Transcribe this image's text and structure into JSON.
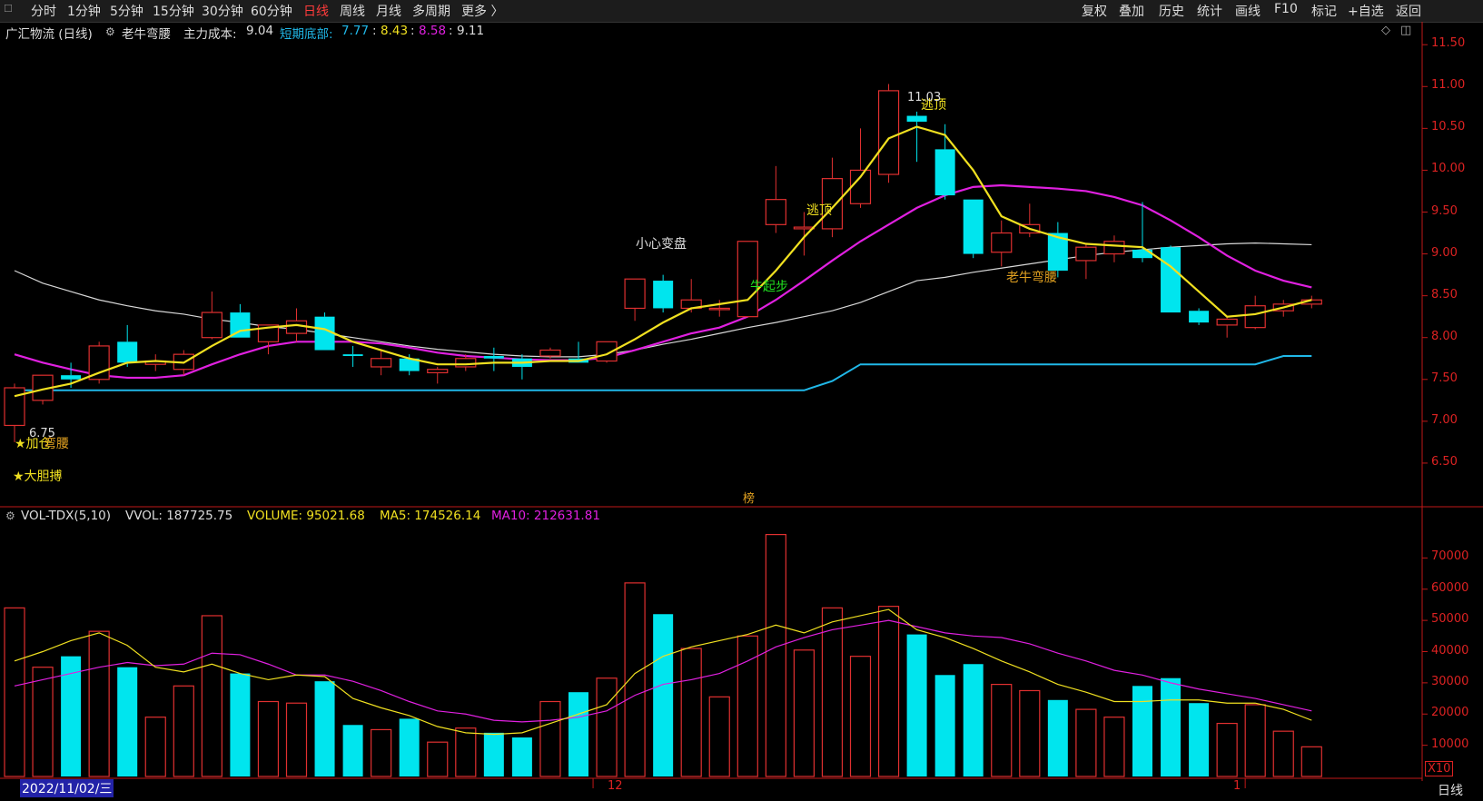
{
  "toolbar": {
    "left_items": [
      "分时",
      "1分钟",
      "5分钟",
      "15分钟",
      "30分钟",
      "60分钟",
      "日线",
      "周线",
      "月线",
      "多周期",
      "更多 〉"
    ],
    "active": "日线",
    "right_items": [
      "复权",
      "叠加",
      "历史",
      "统计",
      "画线",
      "F10",
      "标记",
      "+自选",
      "返回"
    ]
  },
  "header": {
    "stock": "广汇物流 (日线)",
    "indicator": "老牛弯腰",
    "main_cost_label": "主力成本:",
    "main_cost_value": "9.04",
    "short_bottom_label": "短期底部:",
    "v1": "7.77",
    "v2": "8.43",
    "v3": "8.58",
    "v4": "9.11"
  },
  "vol_header": {
    "name": "VOL-TDX(5,10)",
    "vvol": "VVOL: 187725.75",
    "volume": "VOLUME: 95021.68",
    "ma5": "MA5: 174526.14",
    "ma10": "MA10: 212631.81"
  },
  "annotations": {
    "xiaoxin": "小心变盘",
    "taoding1": "逃顶",
    "taoding2": "逃顶",
    "niuqibu": "牛起步",
    "laoniu": "老牛弯腰",
    "jiacang": "★加仓",
    "wanyao": "弯腰",
    "dadan": "★大胆搏",
    "bang": "榜",
    "high_label": "11.03",
    "low_label": "6.75"
  },
  "footer": {
    "date": "2022/11/02/三",
    "month_12": "12",
    "month_1": "1",
    "period": "日线",
    "x10": "X10"
  },
  "colors": {
    "up": "#e03030",
    "down": "#00e5ee",
    "ma_short": "#f0e020",
    "ma_mid": "#e020e0",
    "ma_long": "#d8d8d8",
    "support": "#20b8e8",
    "axis": "#c01818"
  },
  "chart_data": [
    {
      "type": "candlestick",
      "y_axis_ticks": [
        "11.50",
        "11.00",
        "10.50",
        "10.00",
        "9.50",
        "9.00",
        "8.50",
        "8.00",
        "7.50",
        "7.00",
        "6.50"
      ],
      "ylim": [
        6.0,
        11.6
      ],
      "candles": [
        {
          "o": 6.95,
          "h": 7.45,
          "l": 6.75,
          "c": 7.4
        },
        {
          "o": 7.25,
          "h": 7.55,
          "l": 7.2,
          "c": 7.55
        },
        {
          "o": 7.55,
          "h": 7.7,
          "l": 7.4,
          "c": 7.5
        },
        {
          "o": 7.5,
          "h": 7.95,
          "l": 7.45,
          "c": 7.9
        },
        {
          "o": 7.95,
          "h": 8.15,
          "l": 7.65,
          "c": 7.7
        },
        {
          "o": 7.68,
          "h": 7.8,
          "l": 7.6,
          "c": 7.72
        },
        {
          "o": 7.62,
          "h": 7.85,
          "l": 7.55,
          "c": 7.8
        },
        {
          "o": 8.0,
          "h": 8.55,
          "l": 7.98,
          "c": 8.3
        },
        {
          "o": 8.3,
          "h": 8.4,
          "l": 8.0,
          "c": 8.0
        },
        {
          "o": 7.95,
          "h": 8.15,
          "l": 7.8,
          "c": 8.15
        },
        {
          "o": 8.05,
          "h": 8.35,
          "l": 7.95,
          "c": 8.2
        },
        {
          "o": 8.25,
          "h": 8.3,
          "l": 7.85,
          "c": 7.85
        },
        {
          "o": 7.8,
          "h": 7.9,
          "l": 7.65,
          "c": 7.78
        },
        {
          "o": 7.65,
          "h": 7.85,
          "l": 7.55,
          "c": 7.75
        },
        {
          "o": 7.75,
          "h": 7.8,
          "l": 7.55,
          "c": 7.6
        },
        {
          "o": 7.58,
          "h": 7.65,
          "l": 7.45,
          "c": 7.62
        },
        {
          "o": 7.65,
          "h": 7.8,
          "l": 7.6,
          "c": 7.75
        },
        {
          "o": 7.78,
          "h": 7.88,
          "l": 7.6,
          "c": 7.75
        },
        {
          "o": 7.75,
          "h": 7.8,
          "l": 7.5,
          "c": 7.65
        },
        {
          "o": 7.78,
          "h": 7.88,
          "l": 7.75,
          "c": 7.85
        },
        {
          "o": 7.75,
          "h": 7.95,
          "l": 7.7,
          "c": 7.7
        },
        {
          "o": 7.72,
          "h": 7.95,
          "l": 7.7,
          "c": 7.95
        },
        {
          "o": 8.35,
          "h": 8.7,
          "l": 8.2,
          "c": 8.7
        },
        {
          "o": 8.68,
          "h": 8.75,
          "l": 8.3,
          "c": 8.35
        },
        {
          "o": 8.35,
          "h": 8.7,
          "l": 8.3,
          "c": 8.45
        },
        {
          "o": 8.35,
          "h": 8.45,
          "l": 8.25,
          "c": 8.35
        },
        {
          "o": 8.25,
          "h": 9.15,
          "l": 8.25,
          "c": 9.15
        },
        {
          "o": 9.35,
          "h": 10.05,
          "l": 9.25,
          "c": 9.65
        },
        {
          "o": 9.3,
          "h": 9.5,
          "l": 8.98,
          "c": 9.32
        },
        {
          "o": 9.3,
          "h": 10.15,
          "l": 9.2,
          "c": 9.9
        },
        {
          "o": 9.6,
          "h": 10.5,
          "l": 9.55,
          "c": 10.0
        },
        {
          "o": 9.95,
          "h": 11.03,
          "l": 9.85,
          "c": 10.95
        },
        {
          "o": 10.65,
          "h": 10.7,
          "l": 10.1,
          "c": 10.58
        },
        {
          "o": 10.25,
          "h": 10.55,
          "l": 9.65,
          "c": 9.7
        },
        {
          "o": 9.65,
          "h": 9.65,
          "l": 8.95,
          "c": 9.0
        },
        {
          "o": 9.02,
          "h": 9.4,
          "l": 8.85,
          "c": 9.25
        },
        {
          "o": 9.25,
          "h": 9.6,
          "l": 9.2,
          "c": 9.35
        },
        {
          "o": 9.25,
          "h": 9.38,
          "l": 8.72,
          "c": 8.8
        },
        {
          "o": 8.92,
          "h": 9.12,
          "l": 8.7,
          "c": 9.08
        },
        {
          "o": 9.0,
          "h": 9.22,
          "l": 8.9,
          "c": 9.15
        },
        {
          "o": 9.05,
          "h": 9.62,
          "l": 8.9,
          "c": 8.95
        },
        {
          "o": 9.08,
          "h": 9.1,
          "l": 8.3,
          "c": 8.3
        },
        {
          "o": 8.32,
          "h": 8.35,
          "l": 8.15,
          "c": 8.18
        },
        {
          "o": 8.15,
          "h": 8.25,
          "l": 8.0,
          "c": 8.22
        },
        {
          "o": 8.12,
          "h": 8.5,
          "l": 8.1,
          "c": 8.38
        },
        {
          "o": 8.32,
          "h": 8.45,
          "l": 8.25,
          "c": 8.4
        },
        {
          "o": 8.4,
          "h": 8.5,
          "l": 8.35,
          "c": 8.45
        }
      ],
      "series": [
        {
          "name": "short",
          "values": [
            7.3,
            7.38,
            7.45,
            7.58,
            7.7,
            7.72,
            7.7,
            7.9,
            8.08,
            8.12,
            8.15,
            8.1,
            7.95,
            7.85,
            7.75,
            7.68,
            7.68,
            7.7,
            7.7,
            7.72,
            7.72,
            7.8,
            7.98,
            8.18,
            8.35,
            8.4,
            8.45,
            8.8,
            9.2,
            9.55,
            9.92,
            10.38,
            10.52,
            10.42,
            10.0,
            9.45,
            9.3,
            9.2,
            9.12,
            9.1,
            9.08,
            8.85,
            8.55,
            8.25,
            8.28,
            8.36,
            8.45
          ]
        },
        {
          "name": "mid",
          "values": [
            7.8,
            7.7,
            7.62,
            7.55,
            7.52,
            7.52,
            7.55,
            7.68,
            7.8,
            7.9,
            7.95,
            7.95,
            7.95,
            7.93,
            7.88,
            7.82,
            7.78,
            7.76,
            7.74,
            7.73,
            7.73,
            7.76,
            7.85,
            7.95,
            8.05,
            8.12,
            8.25,
            8.45,
            8.68,
            8.92,
            9.15,
            9.35,
            9.55,
            9.7,
            9.8,
            9.82,
            9.8,
            9.78,
            9.75,
            9.68,
            9.58,
            9.4,
            9.2,
            8.98,
            8.8,
            8.68,
            8.6
          ]
        },
        {
          "name": "long",
          "values": [
            8.8,
            8.65,
            8.55,
            8.45,
            8.38,
            8.32,
            8.28,
            8.22,
            8.18,
            8.13,
            8.1,
            8.05,
            8.0,
            7.95,
            7.9,
            7.86,
            7.83,
            7.8,
            7.78,
            7.77,
            7.77,
            7.8,
            7.85,
            7.92,
            7.98,
            8.05,
            8.12,
            8.18,
            8.25,
            8.32,
            8.42,
            8.55,
            8.68,
            8.72,
            8.78,
            8.83,
            8.88,
            8.93,
            8.98,
            9.02,
            9.05,
            9.08,
            9.1,
            9.12,
            9.13,
            9.12,
            9.11
          ]
        },
        {
          "name": "support",
          "values": [
            7.37,
            7.37,
            7.37,
            7.37,
            7.37,
            7.37,
            7.37,
            7.37,
            7.37,
            7.37,
            7.37,
            7.37,
            7.37,
            7.37,
            7.37,
            7.37,
            7.37,
            7.37,
            7.37,
            7.37,
            7.37,
            7.37,
            7.37,
            7.37,
            7.37,
            7.37,
            7.37,
            7.37,
            7.37,
            7.48,
            7.68,
            7.68,
            7.68,
            7.68,
            7.68,
            7.68,
            7.68,
            7.68,
            7.68,
            7.68,
            7.68,
            7.68,
            7.68,
            7.68,
            7.68,
            7.78,
            7.78
          ]
        }
      ]
    },
    {
      "type": "bar",
      "y_axis_ticks": [
        "70000",
        "60000",
        "50000",
        "40000",
        "30000",
        "20000",
        "10000"
      ],
      "ylim": [
        0,
        80000
      ],
      "volume": [
        54000,
        35000,
        38500,
        46500,
        35000,
        19000,
        29000,
        51500,
        33000,
        24000,
        23500,
        30500,
        16500,
        15000,
        18500,
        11000,
        15500,
        14000,
        12500,
        24000,
        27000,
        31500,
        62000,
        52000,
        41000,
        25500,
        45000,
        77500,
        40500,
        54000,
        38500,
        54500,
        45500,
        32500,
        36000,
        29500,
        27500,
        24500,
        21500,
        19000,
        29000,
        31500,
        23500,
        17000,
        23000,
        14500,
        9500
      ],
      "up": [
        true,
        true,
        false,
        true,
        false,
        true,
        true,
        true,
        false,
        true,
        true,
        false,
        false,
        true,
        false,
        true,
        true,
        false,
        false,
        true,
        false,
        true,
        true,
        false,
        true,
        true,
        true,
        true,
        true,
        true,
        true,
        true,
        false,
        false,
        false,
        true,
        true,
        false,
        true,
        true,
        false,
        false,
        false,
        true,
        true,
        true,
        true
      ],
      "series": [
        {
          "name": "MA5",
          "values": [
            37000,
            40000,
            43500,
            46000,
            42000,
            35000,
            33500,
            36000,
            33000,
            31000,
            32500,
            32000,
            25000,
            22000,
            19500,
            16000,
            14000,
            13500,
            14000,
            17000,
            20000,
            23000,
            33000,
            38500,
            41500,
            43500,
            45500,
            48500,
            46000,
            49500,
            51500,
            53500,
            47000,
            44500,
            41000,
            37000,
            33500,
            29500,
            27000,
            24000,
            24000,
            24500,
            24500,
            23500,
            23500,
            21500,
            18000
          ]
        },
        {
          "name": "MA10",
          "values": [
            29000,
            31000,
            33000,
            35000,
            36500,
            35500,
            36000,
            39500,
            39000,
            36000,
            32500,
            32500,
            30500,
            27500,
            24000,
            21000,
            20000,
            18000,
            17500,
            18000,
            19000,
            21000,
            26000,
            29500,
            31000,
            33000,
            37000,
            41500,
            44500,
            47000,
            48500,
            50000,
            48000,
            46000,
            45000,
            44500,
            42500,
            39500,
            37000,
            34000,
            32500,
            30000,
            28000,
            26500,
            25000,
            23000,
            21000
          ]
        }
      ]
    }
  ]
}
